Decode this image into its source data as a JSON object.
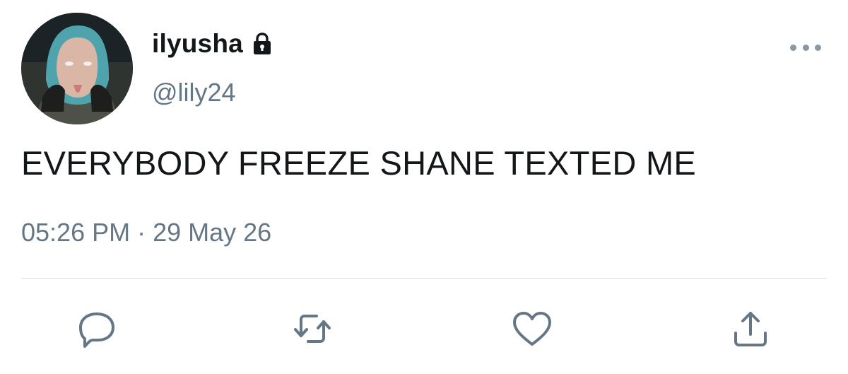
{
  "profile": {
    "display_name": "ilyusha",
    "handle": "@lily24",
    "protected": true
  },
  "tweet": {
    "text": "EVERYBODY FREEZE SHANE TEXTED ME",
    "timestamp": "05:26 PM · 29 May 26"
  },
  "icons": {
    "avatar": "profile-photo",
    "lock": "lock-icon",
    "more": "more-options-icon",
    "reply": "reply-icon",
    "retweet": "retweet-icon",
    "like": "heart-icon",
    "share": "share-icon"
  },
  "colors": {
    "text_primary": "#14171a",
    "text_secondary": "#657786",
    "icon": "#657786",
    "divider": "#d9dfe3"
  }
}
